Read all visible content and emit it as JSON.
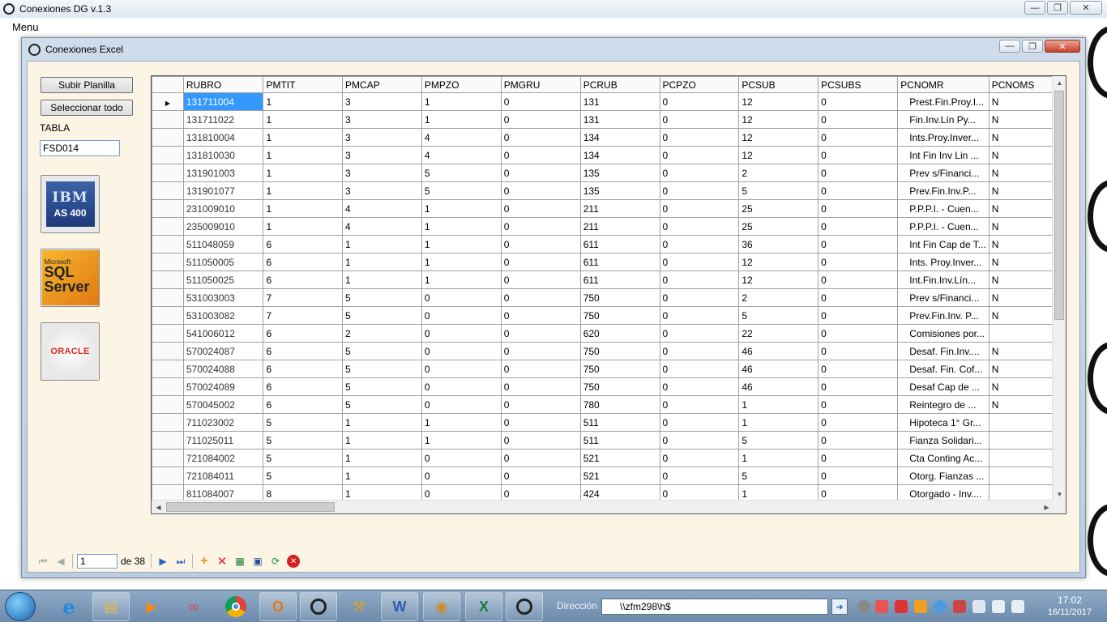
{
  "app": {
    "title": "Conexiones DG v.1.3",
    "menu_label": "Menu"
  },
  "child": {
    "title": "Conexiones Excel"
  },
  "sidebar": {
    "upload_label": "Subir Planilla",
    "select_all_label": "Seleccionar todo",
    "table_label": "TABLA",
    "table_value": "FSD014",
    "ibm_top": "IBM",
    "ibm_bottom": "AS 400",
    "sql_ms": "Microsoft·",
    "sql_line1": "SQL",
    "sql_line2": "Server",
    "oracle_text": "ORACLE"
  },
  "grid": {
    "columns": [
      "RUBRO",
      "PMTIT",
      "PMCAP",
      "PMPZO",
      "PMGRU",
      "PCRUB",
      "PCPZO",
      "PCSUB",
      "PCSUBS",
      "PCNOMR",
      "PCNOMS"
    ],
    "rows": [
      [
        "131711004",
        "1",
        "3",
        "1",
        "0",
        "131",
        "0",
        "12",
        "0",
        "Prest.Fin.Proy.I...",
        "N"
      ],
      [
        "131711022",
        "1",
        "3",
        "1",
        "0",
        "131",
        "0",
        "12",
        "0",
        "Fin.Inv.Lín Py...",
        "N"
      ],
      [
        "131810004",
        "1",
        "3",
        "4",
        "0",
        "134",
        "0",
        "12",
        "0",
        "Ints.Proy.Inver...",
        "N"
      ],
      [
        "131810030",
        "1",
        "3",
        "4",
        "0",
        "134",
        "0",
        "12",
        "0",
        "Int Fin Inv Lin ...",
        "N"
      ],
      [
        "131901003",
        "1",
        "3",
        "5",
        "0",
        "135",
        "0",
        "2",
        "0",
        "Prev s/Financi...",
        "N"
      ],
      [
        "131901077",
        "1",
        "3",
        "5",
        "0",
        "135",
        "0",
        "5",
        "0",
        "Prev.Fin.Inv.P...",
        "N"
      ],
      [
        "231009010",
        "1",
        "4",
        "1",
        "0",
        "211",
        "0",
        "25",
        "0",
        "P.P.P.I. - Cuen...",
        "N"
      ],
      [
        "235009010",
        "1",
        "4",
        "1",
        "0",
        "211",
        "0",
        "25",
        "0",
        "P.P.P.I. - Cuen...",
        "N"
      ],
      [
        "511048059",
        "6",
        "1",
        "1",
        "0",
        "611",
        "0",
        "36",
        "0",
        "Int Fin Cap de T...",
        "N"
      ],
      [
        "511050005",
        "6",
        "1",
        "1",
        "0",
        "611",
        "0",
        "12",
        "0",
        "Ints. Proy.Inver...",
        "N"
      ],
      [
        "511050025",
        "6",
        "1",
        "1",
        "0",
        "611",
        "0",
        "12",
        "0",
        "Int.Fin.Inv.Lín...",
        "N"
      ],
      [
        "531003003",
        "7",
        "5",
        "0",
        "0",
        "750",
        "0",
        "2",
        "0",
        "Prev s/Financi...",
        "N"
      ],
      [
        "531003082",
        "7",
        "5",
        "0",
        "0",
        "750",
        "0",
        "5",
        "0",
        "Prev.Fin.Inv. P...",
        "N"
      ],
      [
        "541006012",
        "6",
        "2",
        "0",
        "0",
        "620",
        "0",
        "22",
        "0",
        "Comisiones por...",
        ""
      ],
      [
        "570024087",
        "6",
        "5",
        "0",
        "0",
        "750",
        "0",
        "46",
        "0",
        "Desaf. Fin.Inv....",
        "N"
      ],
      [
        "570024088",
        "6",
        "5",
        "0",
        "0",
        "750",
        "0",
        "46",
        "0",
        "Desaf. Fin. Cof...",
        "N"
      ],
      [
        "570024089",
        "6",
        "5",
        "0",
        "0",
        "750",
        "0",
        "46",
        "0",
        "Desaf Cap de ...",
        "N"
      ],
      [
        "570045002",
        "6",
        "5",
        "0",
        "0",
        "780",
        "0",
        "1",
        "0",
        "Reintegro de ...",
        "N"
      ],
      [
        "711023002",
        "5",
        "1",
        "1",
        "0",
        "511",
        "0",
        "1",
        "0",
        "Hipoteca 1° Gr...",
        ""
      ],
      [
        "711025011",
        "5",
        "1",
        "1",
        "0",
        "511",
        "0",
        "5",
        "0",
        "Fianza Solidari...",
        ""
      ],
      [
        "721084002",
        "5",
        "1",
        "0",
        "0",
        "521",
        "0",
        "1",
        "0",
        "Cta Conting Ac...",
        ""
      ],
      [
        "721084011",
        "5",
        "1",
        "0",
        "0",
        "521",
        "0",
        "5",
        "0",
        "Otorg. Fianzas ...",
        ""
      ],
      [
        "811084007",
        "8",
        "1",
        "0",
        "0",
        "424",
        "0",
        "1",
        "0",
        "Otorgado - Inv....",
        ""
      ]
    ]
  },
  "navigator": {
    "position": "1",
    "count_label": "de 38"
  },
  "taskbar": {
    "address_label": "Dirección",
    "address_value": "\\\\zfm298\\h$",
    "time": "17:02",
    "date": "16/11/2017"
  }
}
